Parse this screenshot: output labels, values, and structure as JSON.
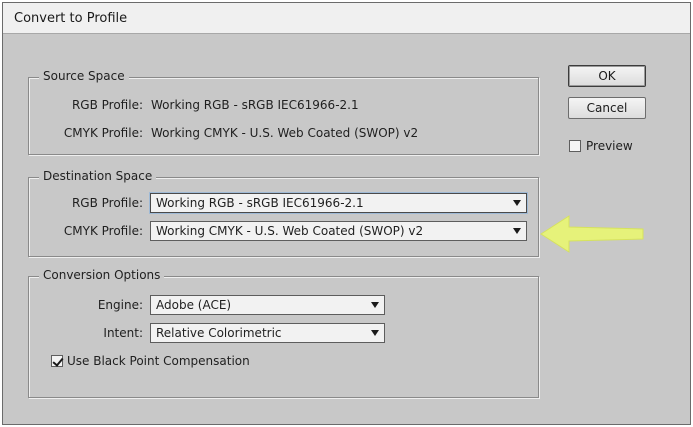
{
  "window": {
    "title": "Convert to Profile"
  },
  "source_space": {
    "legend": "Source Space",
    "rgb_label": "RGB Profile:",
    "rgb_value": "Working RGB - sRGB IEC61966-2.1",
    "cmyk_label": "CMYK Profile:",
    "cmyk_value": "Working CMYK - U.S. Web Coated (SWOP) v2"
  },
  "destination_space": {
    "legend": "Destination Space",
    "rgb_label": "RGB Profile:",
    "rgb_selected": "Working RGB - sRGB IEC61966-2.1",
    "cmyk_label": "CMYK Profile:",
    "cmyk_selected": "Working CMYK - U.S. Web Coated (SWOP) v2"
  },
  "conversion_options": {
    "legend": "Conversion Options",
    "engine_label": "Engine:",
    "engine_selected": "Adobe (ACE)",
    "intent_label": "Intent:",
    "intent_selected": "Relative Colorimetric",
    "black_point_label": "Use Black Point Compensation",
    "black_point_checked": true
  },
  "buttons": {
    "ok_label": "OK",
    "cancel_label": "Cancel"
  },
  "preview": {
    "label": "Preview",
    "checked": false
  },
  "annotation": {
    "arrow_color": "#e6f27a",
    "arrow_points_to": "destination_space.cmyk_selected"
  },
  "colors": {
    "dialog_bg": "#c8c8c8",
    "titlebar_bg": "#f0f0f0",
    "highlight_ring": "#9fbad6"
  }
}
